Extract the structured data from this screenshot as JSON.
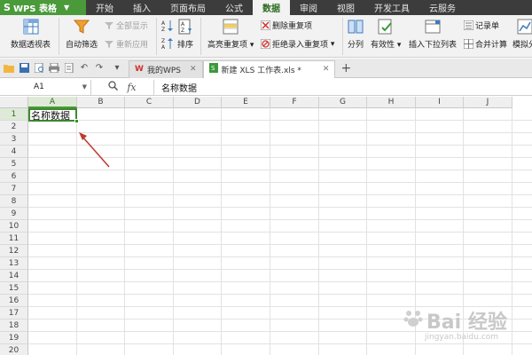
{
  "app": {
    "name": "WPS 表格"
  },
  "menu": [
    "开始",
    "插入",
    "页面布局",
    "公式",
    "数据",
    "审阅",
    "视图",
    "开发工具",
    "云服务"
  ],
  "menu_active": "数据",
  "ribbon": {
    "pivot": "数据透视表",
    "autofilter": "自动筛选",
    "show_all": "全部显示",
    "reapply": "重新应用",
    "sort": "排序",
    "highlight_dup": "高亮重复项",
    "remove_dup": "删除重复项",
    "reject_dup": "拒绝录入重复项",
    "split": "分列",
    "validity": "有效性",
    "dropdown": "插入下拉列表",
    "record": "记录单",
    "merge_calc": "合并计算",
    "simulate": "模拟分"
  },
  "doc_tabs": [
    {
      "label": "我的WPS"
    },
    {
      "label": "新建 XLS 工作表.xls *"
    }
  ],
  "formula_bar": {
    "name_box": "A1",
    "fx": "fx",
    "content": "名称数据"
  },
  "columns": [
    "A",
    "B",
    "C",
    "D",
    "E",
    "F",
    "G",
    "H",
    "I",
    "J"
  ],
  "rows": [
    "1",
    "2",
    "3",
    "4",
    "5",
    "6",
    "7",
    "8",
    "9",
    "10",
    "11",
    "12",
    "13",
    "14",
    "15",
    "16",
    "17",
    "18",
    "19",
    "20"
  ],
  "cell_a1": "名称数据",
  "watermark": {
    "text": "Bai 经验",
    "sub": "jingyan.baidu.com"
  },
  "colors": {
    "accent": "#4a9a3a",
    "menubar": "#3c3c3c",
    "arrow": "#c0392b"
  }
}
